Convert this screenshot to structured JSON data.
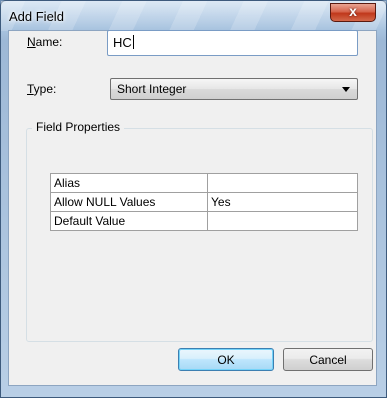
{
  "window": {
    "title": "Add Field",
    "close_label": "x"
  },
  "form": {
    "name_label_access": "N",
    "name_label_rest": "ame:",
    "name_value": "HC",
    "type_label_access": "T",
    "type_label_rest": "ype:",
    "type_value": "Short Integer"
  },
  "field_properties": {
    "legend": "Field Properties",
    "rows": [
      {
        "property": "Alias",
        "value": ""
      },
      {
        "property": "Allow NULL Values",
        "value": "Yes"
      },
      {
        "property": "Default Value",
        "value": ""
      }
    ]
  },
  "buttons": {
    "ok": "OK",
    "cancel": "Cancel"
  },
  "icons": {
    "close": "close-icon",
    "dropdown": "chevron-down-icon"
  }
}
